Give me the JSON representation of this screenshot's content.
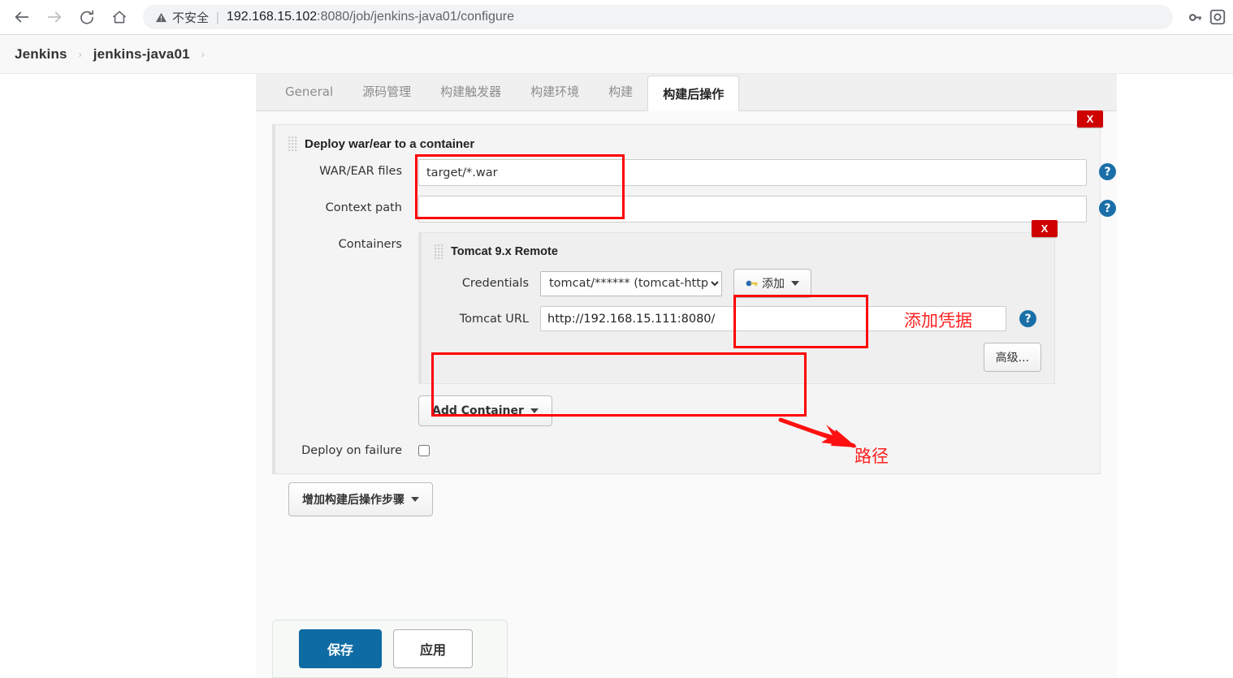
{
  "browser": {
    "back_icon": "back-arrow-icon",
    "forward_icon": "forward-arrow-icon",
    "reload_icon": "reload-icon",
    "home_icon": "home-icon",
    "security_icon": "warning-triangle-icon",
    "security_label": "不安全",
    "separator": "|",
    "url_host": "192.168.15.102",
    "url_port": ":8080",
    "url_path": "/job/jenkins-java01/configure",
    "url_full": "192.168.15.102:8080/job/jenkins-java01/configure",
    "password_key_icon": "key-icon",
    "extension_icon": "extension-icon"
  },
  "breadcrumb": {
    "items": [
      {
        "label": "Jenkins"
      },
      {
        "label": "jenkins-java01"
      }
    ],
    "separator": "›"
  },
  "tabs": [
    {
      "label": "General",
      "active": false
    },
    {
      "label": "源码管理",
      "active": false
    },
    {
      "label": "构建触发器",
      "active": false
    },
    {
      "label": "构建环境",
      "active": false
    },
    {
      "label": "构建",
      "active": false
    },
    {
      "label": "构建后操作",
      "active": true
    }
  ],
  "publisher": {
    "title": "Deploy war/ear to a container",
    "delete_label": "X",
    "fields": {
      "war_label": "WAR/EAR files",
      "war_value": "target/*.war",
      "war_placeholder": "",
      "context_label": "Context path",
      "context_value": "",
      "context_placeholder": "",
      "containers_label": "Containers",
      "deploy_on_failure_label": "Deploy on failure",
      "deploy_on_failure_checked": false
    },
    "help_label": "?"
  },
  "container": {
    "title": "Tomcat 9.x Remote",
    "delete_label": "X",
    "credentials_label": "Credentials",
    "credentials_value": "tomcat/****** (tomcat-http)",
    "credentials_options": [
      "tomcat/****** (tomcat-http)"
    ],
    "add_credentials_label": "添加",
    "add_credentials_icon": "key-icon",
    "tomcat_url_label": "Tomcat URL",
    "tomcat_url_value": "http://192.168.15.111:8080/",
    "advanced_label": "高级...",
    "add_container_label": "Add Container"
  },
  "footer": {
    "add_post_step_label": "增加构建后操作步骤",
    "save_label": "保存",
    "apply_label": "应用"
  },
  "annotations": [
    {
      "name": "add-credentials-note",
      "text": "添加凭据"
    },
    {
      "name": "path-note",
      "text": "路径"
    }
  ],
  "colors": {
    "accent_blue": "#0f6ba3",
    "annotation_red": "#ff2020",
    "delete_red": "#cf0000",
    "help_blue": "#1a6fa8"
  }
}
